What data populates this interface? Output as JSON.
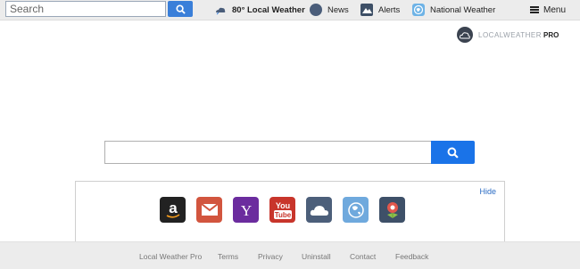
{
  "toolbar": {
    "search_placeholder": "Search",
    "weather_label": "80° Local Weather",
    "news_label": "News",
    "alerts_label": "Alerts",
    "national_weather_label": "National Weather",
    "menu_label": "Menu",
    "icons": {
      "search": "search-icon",
      "weather": "weather-cloud-icon",
      "news": "news-icon",
      "alerts": "alerts-icon",
      "national_weather": "globe-icon",
      "menu": "hamburger-menu-icon"
    }
  },
  "brand": {
    "text": "LOCALWEATHER",
    "pro": "PRO"
  },
  "main_search": {
    "placeholder": "",
    "button_icon": "search-icon"
  },
  "shortcuts": {
    "hide_label": "Hide",
    "tiles": [
      {
        "name": "amazon",
        "glyph": "a",
        "color": "#222222"
      },
      {
        "name": "gmail",
        "glyph": "✉",
        "color": "#d2553e"
      },
      {
        "name": "yahoo",
        "glyph": "Y",
        "color": "#6b2c9e"
      },
      {
        "name": "youtube",
        "glyph": "You Tube",
        "color": "#c8352b"
      },
      {
        "name": "weather",
        "glyph": "☁",
        "color": "#4c5f7a"
      },
      {
        "name": "globe",
        "glyph": "◍",
        "color": "#6fa9dd"
      },
      {
        "name": "map-pin",
        "glyph": "✿",
        "color": "#3e5068"
      }
    ]
  },
  "footer": {
    "links": [
      "Local Weather Pro",
      "Terms",
      "Privacy",
      "Uninstall",
      "Contact",
      "Feedback"
    ]
  },
  "colors": {
    "accent": "#1a73e8",
    "toolbar_bg": "#ececec",
    "link": "#2b6cc4"
  }
}
